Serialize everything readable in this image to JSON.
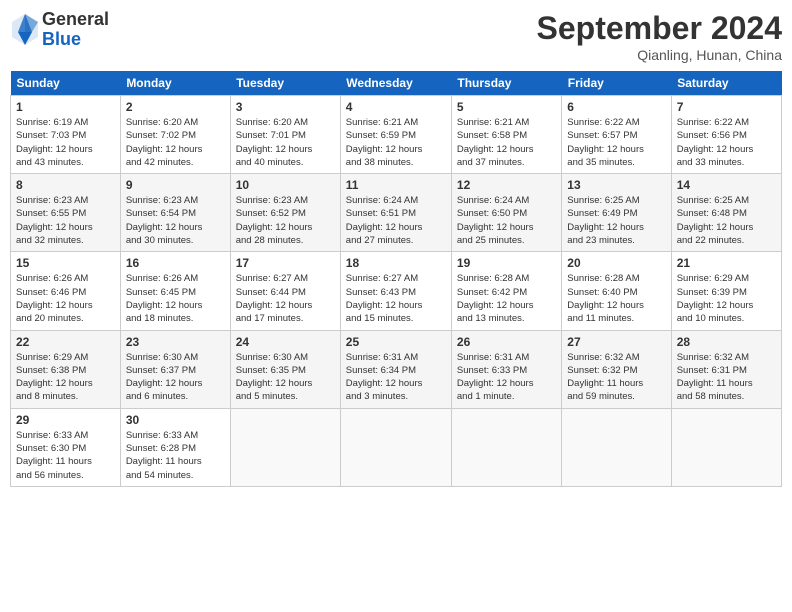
{
  "header": {
    "logo_general": "General",
    "logo_blue": "Blue",
    "title": "September 2024",
    "location": "Qianling, Hunan, China"
  },
  "days_of_week": [
    "Sunday",
    "Monday",
    "Tuesday",
    "Wednesday",
    "Thursday",
    "Friday",
    "Saturday"
  ],
  "weeks": [
    [
      {
        "day": "1",
        "info": "Sunrise: 6:19 AM\nSunset: 7:03 PM\nDaylight: 12 hours\nand 43 minutes."
      },
      {
        "day": "2",
        "info": "Sunrise: 6:20 AM\nSunset: 7:02 PM\nDaylight: 12 hours\nand 42 minutes."
      },
      {
        "day": "3",
        "info": "Sunrise: 6:20 AM\nSunset: 7:01 PM\nDaylight: 12 hours\nand 40 minutes."
      },
      {
        "day": "4",
        "info": "Sunrise: 6:21 AM\nSunset: 6:59 PM\nDaylight: 12 hours\nand 38 minutes."
      },
      {
        "day": "5",
        "info": "Sunrise: 6:21 AM\nSunset: 6:58 PM\nDaylight: 12 hours\nand 37 minutes."
      },
      {
        "day": "6",
        "info": "Sunrise: 6:22 AM\nSunset: 6:57 PM\nDaylight: 12 hours\nand 35 minutes."
      },
      {
        "day": "7",
        "info": "Sunrise: 6:22 AM\nSunset: 6:56 PM\nDaylight: 12 hours\nand 33 minutes."
      }
    ],
    [
      {
        "day": "8",
        "info": "Sunrise: 6:23 AM\nSunset: 6:55 PM\nDaylight: 12 hours\nand 32 minutes."
      },
      {
        "day": "9",
        "info": "Sunrise: 6:23 AM\nSunset: 6:54 PM\nDaylight: 12 hours\nand 30 minutes."
      },
      {
        "day": "10",
        "info": "Sunrise: 6:23 AM\nSunset: 6:52 PM\nDaylight: 12 hours\nand 28 minutes."
      },
      {
        "day": "11",
        "info": "Sunrise: 6:24 AM\nSunset: 6:51 PM\nDaylight: 12 hours\nand 27 minutes."
      },
      {
        "day": "12",
        "info": "Sunrise: 6:24 AM\nSunset: 6:50 PM\nDaylight: 12 hours\nand 25 minutes."
      },
      {
        "day": "13",
        "info": "Sunrise: 6:25 AM\nSunset: 6:49 PM\nDaylight: 12 hours\nand 23 minutes."
      },
      {
        "day": "14",
        "info": "Sunrise: 6:25 AM\nSunset: 6:48 PM\nDaylight: 12 hours\nand 22 minutes."
      }
    ],
    [
      {
        "day": "15",
        "info": "Sunrise: 6:26 AM\nSunset: 6:46 PM\nDaylight: 12 hours\nand 20 minutes."
      },
      {
        "day": "16",
        "info": "Sunrise: 6:26 AM\nSunset: 6:45 PM\nDaylight: 12 hours\nand 18 minutes."
      },
      {
        "day": "17",
        "info": "Sunrise: 6:27 AM\nSunset: 6:44 PM\nDaylight: 12 hours\nand 17 minutes."
      },
      {
        "day": "18",
        "info": "Sunrise: 6:27 AM\nSunset: 6:43 PM\nDaylight: 12 hours\nand 15 minutes."
      },
      {
        "day": "19",
        "info": "Sunrise: 6:28 AM\nSunset: 6:42 PM\nDaylight: 12 hours\nand 13 minutes."
      },
      {
        "day": "20",
        "info": "Sunrise: 6:28 AM\nSunset: 6:40 PM\nDaylight: 12 hours\nand 11 minutes."
      },
      {
        "day": "21",
        "info": "Sunrise: 6:29 AM\nSunset: 6:39 PM\nDaylight: 12 hours\nand 10 minutes."
      }
    ],
    [
      {
        "day": "22",
        "info": "Sunrise: 6:29 AM\nSunset: 6:38 PM\nDaylight: 12 hours\nand 8 minutes."
      },
      {
        "day": "23",
        "info": "Sunrise: 6:30 AM\nSunset: 6:37 PM\nDaylight: 12 hours\nand 6 minutes."
      },
      {
        "day": "24",
        "info": "Sunrise: 6:30 AM\nSunset: 6:35 PM\nDaylight: 12 hours\nand 5 minutes."
      },
      {
        "day": "25",
        "info": "Sunrise: 6:31 AM\nSunset: 6:34 PM\nDaylight: 12 hours\nand 3 minutes."
      },
      {
        "day": "26",
        "info": "Sunrise: 6:31 AM\nSunset: 6:33 PM\nDaylight: 12 hours\nand 1 minute."
      },
      {
        "day": "27",
        "info": "Sunrise: 6:32 AM\nSunset: 6:32 PM\nDaylight: 11 hours\nand 59 minutes."
      },
      {
        "day": "28",
        "info": "Sunrise: 6:32 AM\nSunset: 6:31 PM\nDaylight: 11 hours\nand 58 minutes."
      }
    ],
    [
      {
        "day": "29",
        "info": "Sunrise: 6:33 AM\nSunset: 6:30 PM\nDaylight: 11 hours\nand 56 minutes."
      },
      {
        "day": "30",
        "info": "Sunrise: 6:33 AM\nSunset: 6:28 PM\nDaylight: 11 hours\nand 54 minutes."
      },
      {
        "day": "",
        "info": ""
      },
      {
        "day": "",
        "info": ""
      },
      {
        "day": "",
        "info": ""
      },
      {
        "day": "",
        "info": ""
      },
      {
        "day": "",
        "info": ""
      }
    ]
  ]
}
